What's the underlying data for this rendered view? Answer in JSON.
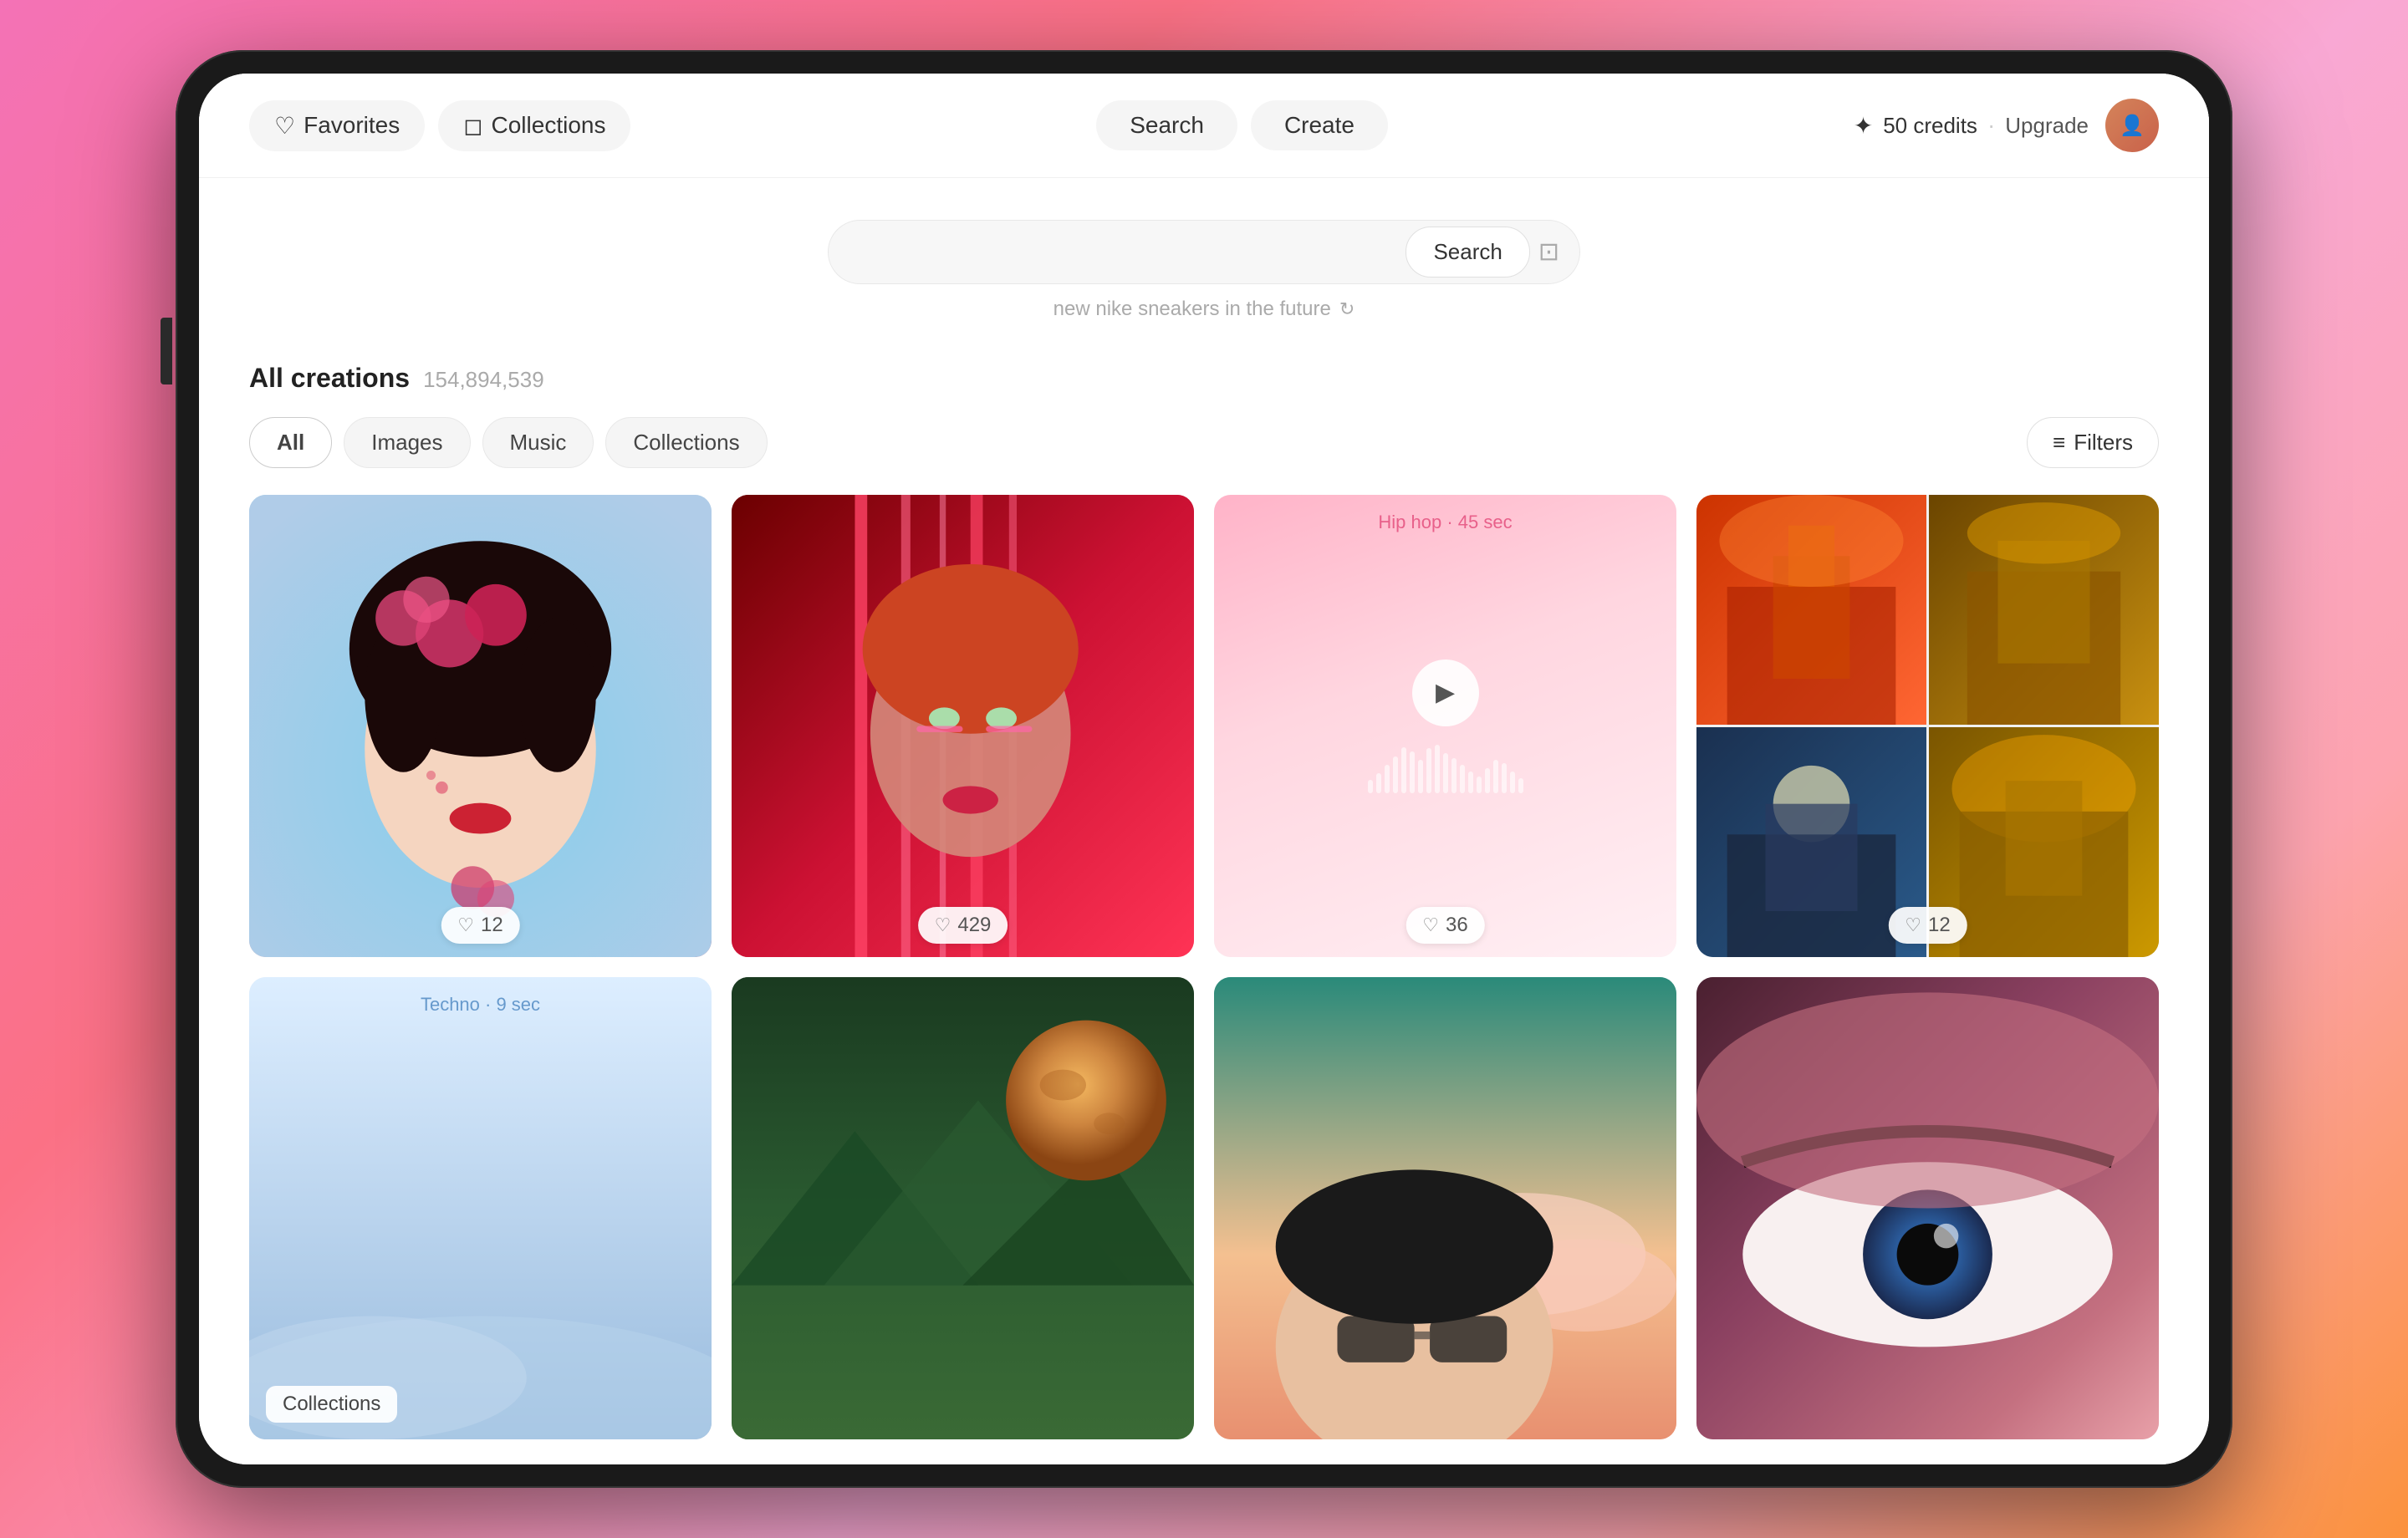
{
  "tablet": {
    "background_gradient": "linear-gradient(135deg, #f472b6 0%, #fb7185 30%, #f9a8d4 60%, #fda4af 80%, #fb923c 100%)"
  },
  "header": {
    "favorites_label": "Favorites",
    "collections_label": "Collections",
    "search_label": "Search",
    "create_label": "Create",
    "credits_icon_label": "✦",
    "credits_value": "50 credits",
    "dot_separator": "·",
    "upgrade_label": "Upgrade"
  },
  "search": {
    "placeholder": "",
    "cursor_visible": true,
    "search_button_label": "Search",
    "hint_text": "new nike sneakers in the future"
  },
  "creations": {
    "title": "All creations",
    "count": "154,894,539"
  },
  "tabs": {
    "all_label": "All",
    "images_label": "Images",
    "music_label": "Music",
    "collections_label": "Collections",
    "filters_label": "Filters"
  },
  "grid": {
    "items": [
      {
        "type": "image",
        "style": "asian-woman",
        "likes": "12",
        "alt": "Asian woman with red flowers"
      },
      {
        "type": "image",
        "style": "red-woman",
        "likes": "429",
        "alt": "Woman in red light"
      },
      {
        "type": "music",
        "genre": "Hip hop",
        "duration": "45 sec",
        "likes": "36",
        "style": "music"
      },
      {
        "type": "collection",
        "style": "castle-grid",
        "likes": "12",
        "alt": "Fantasy castle collection"
      },
      {
        "type": "music",
        "genre": "Techno",
        "duration": "9 sec",
        "likes": null,
        "style": "techno"
      },
      {
        "type": "image",
        "style": "mars",
        "likes": null,
        "alt": "Mars landscape"
      },
      {
        "type": "image",
        "style": "glasses-woman",
        "likes": null,
        "alt": "Woman with glasses in clouds"
      },
      {
        "type": "image",
        "style": "eye",
        "likes": null,
        "alt": "Close up eye"
      }
    ],
    "collections_tab_label": "Collections"
  },
  "waveform_bars": [
    8,
    14,
    22,
    30,
    42,
    55,
    48,
    38,
    52,
    58,
    50,
    44,
    36,
    28,
    22,
    18,
    30,
    42,
    38,
    28
  ]
}
